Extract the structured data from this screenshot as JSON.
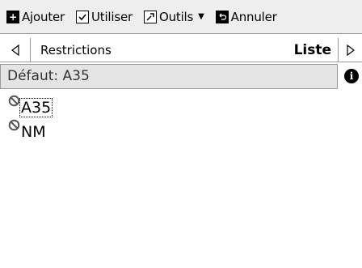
{
  "toolbar": {
    "add_label": "Ajouter",
    "use_label": "Utiliser",
    "tools_label": "Outils",
    "cancel_label": "Annuler"
  },
  "nav": {
    "title": "Restrictions",
    "mode": "Liste"
  },
  "default": {
    "text": "Défaut: A35"
  },
  "list": {
    "items": [
      {
        "label": "A35",
        "selected": true
      },
      {
        "label": "NM",
        "selected": false
      }
    ]
  }
}
